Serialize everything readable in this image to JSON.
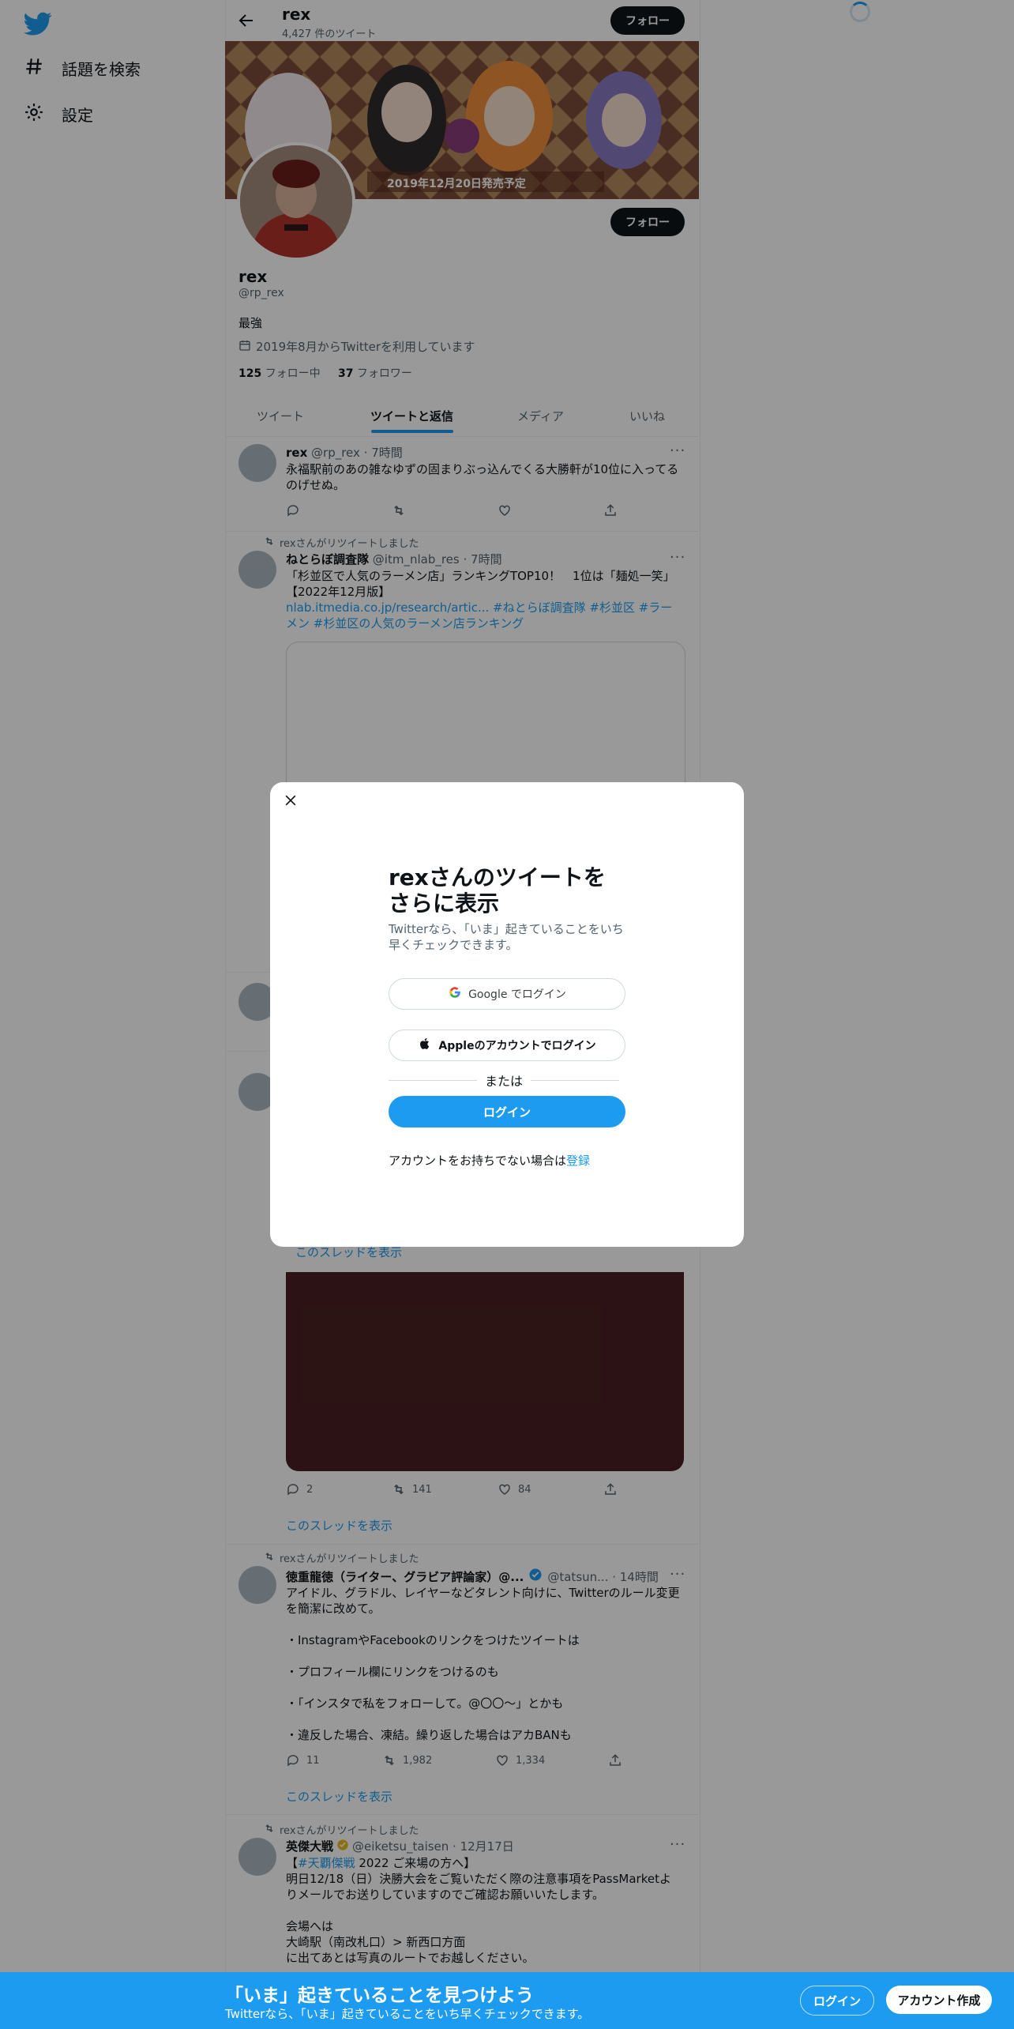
{
  "nav": {
    "explore_label": "話題を検索",
    "settings_label": "設定"
  },
  "header": {
    "name": "rex",
    "tweet_count": "4,427 件のツイート",
    "follow_label": "フォロー"
  },
  "banner": {
    "caption": "2019年12月20日発売予定"
  },
  "profile": {
    "name": "rex",
    "handle": "@rp_rex",
    "bio": "最強",
    "joined": "2019年8月からTwitterを利用しています",
    "following_count": "125",
    "following_label": "フォロー中",
    "followers_count": "37",
    "followers_label": "フォロワー",
    "follow_label": "フォロー"
  },
  "tabs": [
    {
      "label": "ツイート"
    },
    {
      "label": "ツイートと返信"
    },
    {
      "label": "メディア"
    },
    {
      "label": "いいね"
    }
  ],
  "tweets": [
    {
      "name": "rex",
      "meta": "@rp_rex · 7時間",
      "text": "永福駅前のあの雑なゆずの固まりぶっ込んでくる大勝軒が10位に入ってるのげせぬ。"
    },
    {
      "retweet_label": "rexさんがリツイートしました",
      "name": "ねとらぼ調査隊",
      "meta": "@itm_nlab_res · 7時間",
      "text": "「杉並区で人気のラーメン店」ランキングTOP10！　1位は「麺処一笑」【2022年12月版】",
      "link_text": "nlab.itmedia.co.jp/research/artic... #ねとらぼ調査隊 #杉並区 #ラーメン #杉並区の人気のラーメン店ランキング"
    },
    {
      "thread_label": "このスレッドを表示",
      "replies": "2",
      "retweets": "141",
      "likes": "84",
      "thread_label_2": "このスレッドを表示"
    },
    {
      "retweet_label": "rexさんがリツイートしました",
      "name": "徳重龍徳（ライター、グラビア評論家）@...",
      "meta": "@tatsun... · 14時間",
      "lines": [
        "アイドル、グラドル、レイヤーなどタレント向けに、Twitterのルール変更を簡潔に改めて。",
        "・InstagramやFacebookのリンクをつけたツイートは",
        "・プロフィール欄にリンクをつけるのも",
        "・「インスタで私をフォローして。@〇〇〜」とかも",
        "・違反した場合、凍結。繰り返した場合はアカBANも"
      ],
      "replies": "11",
      "retweets": "1,982",
      "likes": "1,334",
      "thread_label": "このスレッドを表示"
    },
    {
      "retweet_label": "rexさんがリツイートしました",
      "name": "英傑大戦",
      "meta": "@eiketsu_taisen · 12月17日",
      "hashtag": "#天覇傑戦",
      "line1_rest": " 2022 ご来場の方へ】",
      "line2": "明日12/18（日）決勝大会をご覧いただく際の注意事項をPassMarketよりメールでお送りしていますのでご確認お願いいたします。",
      "line3": "会場へは",
      "line4": "大崎駅（南改札口）> 新西口方面",
      "line5": "に出てあとは写真のルートでお越しください。"
    }
  ],
  "modal": {
    "title": "rexさんのツイートをさらに表示",
    "subtitle": "Twitterなら、「いま」起きていることをいち早くチェックできます。",
    "google_label": "Google でログイン",
    "apple_label": "Appleのアカウントでログイン",
    "or_label": "または",
    "login_label": "ログイン",
    "no_account": "アカウントをお持ちでない場合は",
    "signup_label": "登録"
  },
  "bottom_bar": {
    "title": "「いま」起きていることを見つけよう",
    "subtitle": "Twitterなら、「いま」起きていることをいち早くチェックできます。",
    "login_label": "ログイン",
    "signup_label": "アカウント作成"
  },
  "colors": {
    "accent": "#1d9bf0",
    "text": "#0f1419",
    "secondary": "#536471",
    "overlay": "rgba(0,0,0,0.4)"
  }
}
